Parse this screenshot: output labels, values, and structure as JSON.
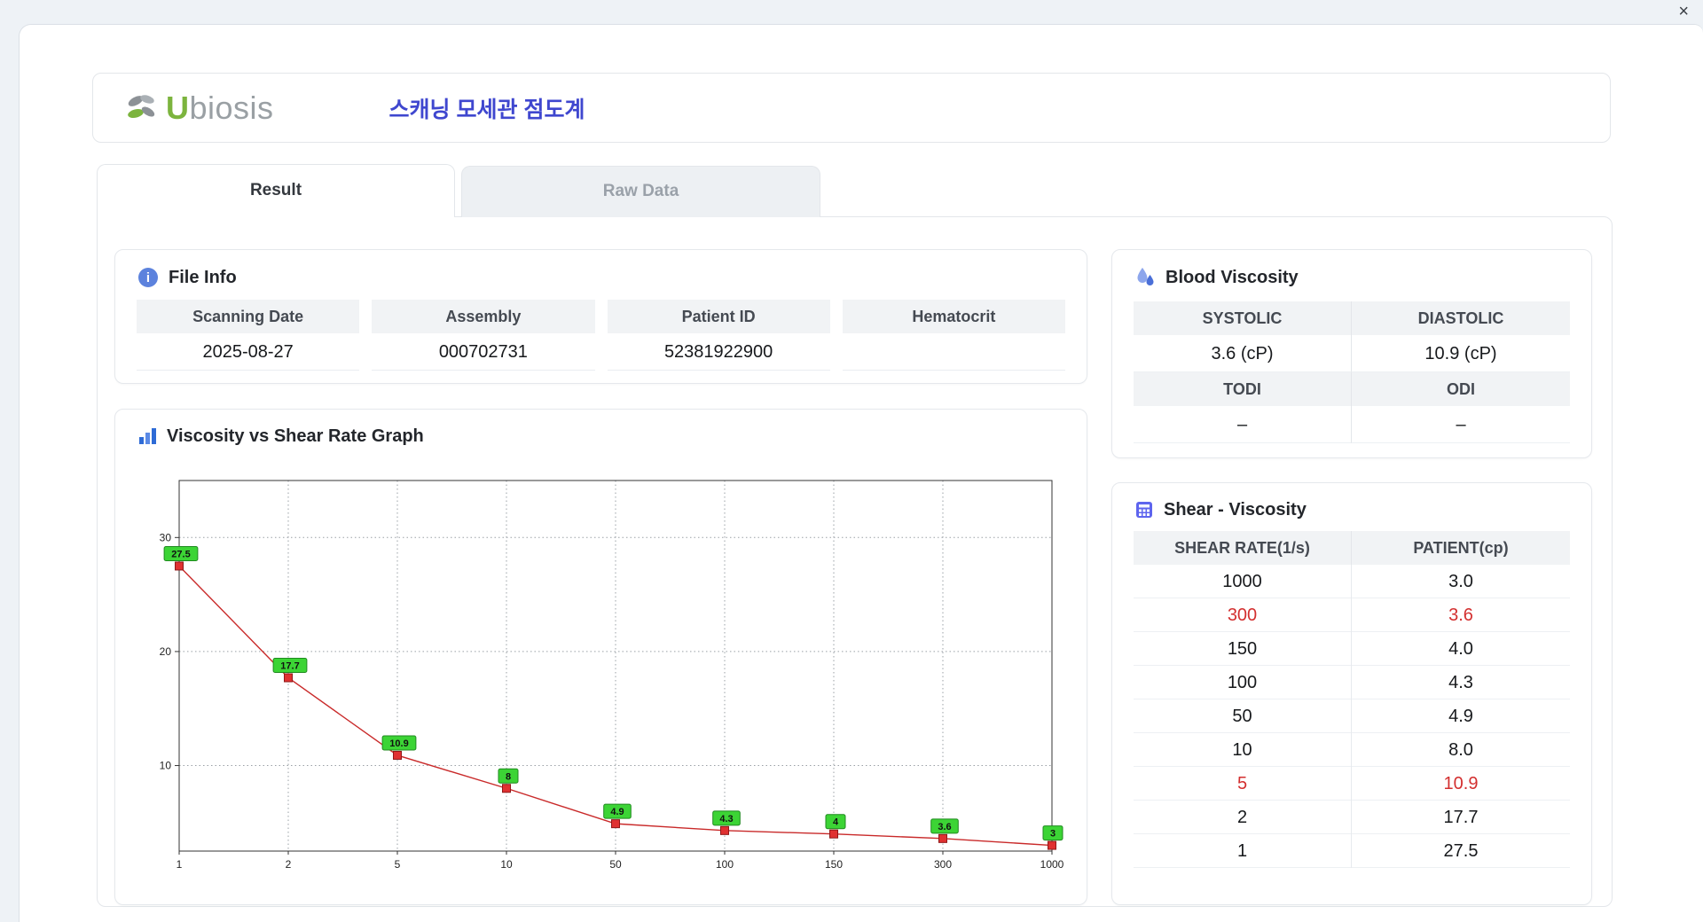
{
  "window": {
    "close_label": "×"
  },
  "header": {
    "logo_u": "U",
    "logo_rest": "biosis",
    "app_title": "스캐닝 모세관 점도계"
  },
  "tabs": {
    "result": "Result",
    "raw_data": "Raw Data"
  },
  "file_info": {
    "title": "File Info",
    "fields": [
      {
        "label": "Scanning Date",
        "value": "2025-08-27"
      },
      {
        "label": "Assembly",
        "value": "000702731"
      },
      {
        "label": "Patient ID",
        "value": "52381922900"
      },
      {
        "label": "Hematocrit",
        "value": ""
      }
    ]
  },
  "blood_viscosity": {
    "title": "Blood Viscosity",
    "groups": [
      {
        "cells": [
          {
            "label": "SYSTOLIC",
            "value": "3.6 (cP)"
          },
          {
            "label": "DIASTOLIC",
            "value": "10.9 (cP)"
          }
        ]
      },
      {
        "cells": [
          {
            "label": "TODI",
            "value": "–"
          },
          {
            "label": "ODI",
            "value": "–"
          }
        ]
      }
    ]
  },
  "graph": {
    "title": "Viscosity vs Shear Rate Graph"
  },
  "shear_viscosity": {
    "title": "Shear - Viscosity",
    "columns": [
      "SHEAR RATE(1/s)",
      "PATIENT(cp)"
    ],
    "rows": [
      {
        "shear_rate": "1000",
        "patient": "3.0",
        "highlight": false
      },
      {
        "shear_rate": "300",
        "patient": "3.6",
        "highlight": true
      },
      {
        "shear_rate": "150",
        "patient": "4.0",
        "highlight": false
      },
      {
        "shear_rate": "100",
        "patient": "4.3",
        "highlight": false
      },
      {
        "shear_rate": "50",
        "patient": "4.9",
        "highlight": false
      },
      {
        "shear_rate": "10",
        "patient": "8.0",
        "highlight": false
      },
      {
        "shear_rate": "5",
        "patient": "10.9",
        "highlight": true
      },
      {
        "shear_rate": "2",
        "patient": "17.7",
        "highlight": false
      },
      {
        "shear_rate": "1",
        "patient": "27.5",
        "highlight": false
      }
    ]
  },
  "chart_data": {
    "type": "line",
    "title": "Viscosity vs Shear Rate Graph",
    "x": [
      1,
      2,
      5,
      10,
      50,
      100,
      150,
      300,
      1000
    ],
    "x_tick_labels": [
      "1",
      "2",
      "5",
      "10",
      "50",
      "100",
      "150",
      "300",
      "1000"
    ],
    "values": [
      27.5,
      17.7,
      10.9,
      8,
      4.9,
      4.3,
      4,
      3.6,
      3
    ],
    "point_labels": [
      "27.5",
      "17.7",
      "10.9",
      "8",
      "4.9",
      "4.3",
      "4",
      "3.6",
      "3"
    ],
    "y_ticks": [
      10,
      20,
      30
    ],
    "ylim": [
      2.5,
      35
    ],
    "x_axis_type": "category",
    "grid": "dotted",
    "xlabel": "",
    "ylabel": "",
    "legend": "none",
    "line_color": "#c92a2a",
    "marker_color": "#e03131",
    "marker_border": "#8f1818",
    "point_label_bg": "#3cd435",
    "point_label_border": "#1f8a1f"
  },
  "colors": {
    "accent_blue": "#3f47cf",
    "highlight_red": "#d32f2f",
    "card_border": "#e3e6ea",
    "table_header_bg": "#f1f3f5",
    "logo_green": "#7cb43e",
    "logo_gray": "#9aa0a4"
  }
}
